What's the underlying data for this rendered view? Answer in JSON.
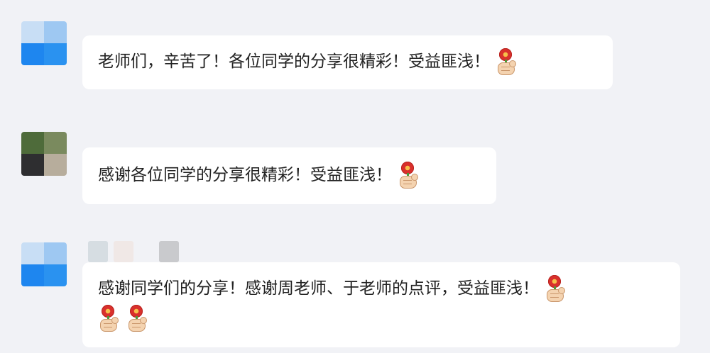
{
  "messages": [
    {
      "text": "老师们，辛苦了！各位同学的分享很精彩！受益匪浅！",
      "emoji": "rose-icon",
      "emoji_count": 1
    },
    {
      "text": "感谢各位同学的分享很精彩！受益匪浅！",
      "emoji": "rose-icon",
      "emoji_count": 1
    },
    {
      "text": "感谢同学们的分享！感谢周老师、于老师的点评，受益匪浅！",
      "emoji": "rose-icon",
      "emoji_count": 1,
      "second_line_emoji_count": 2
    }
  ],
  "colors": {
    "background": "#f1f2f6",
    "bubble": "#ffffff",
    "text": "#222222",
    "avatar_blue": "#1e8cf0",
    "avatar_light_blue": "#a9cff3"
  }
}
